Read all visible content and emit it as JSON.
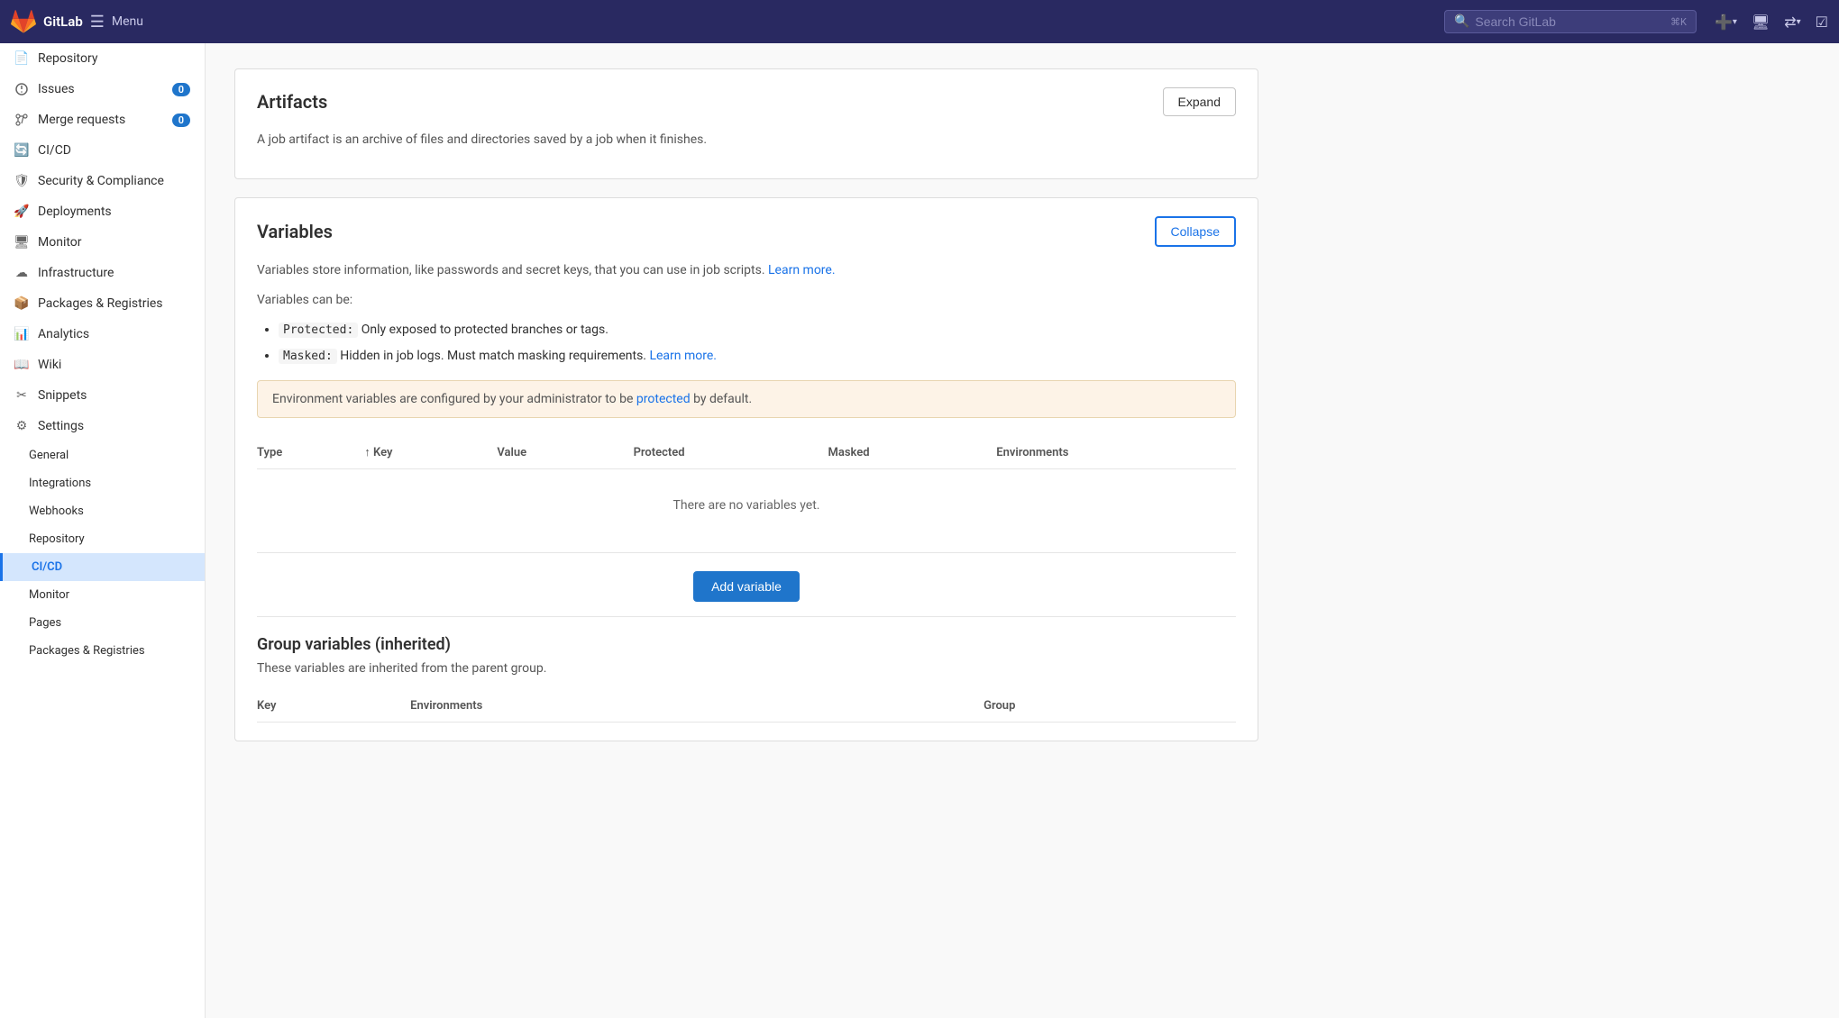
{
  "navbar": {
    "logo_text": "GitLab",
    "menu_label": "Menu",
    "search_placeholder": "Search GitLab"
  },
  "sidebar": {
    "items": [
      {
        "id": "repository",
        "label": "Repository",
        "icon": "repo-icon"
      },
      {
        "id": "issues",
        "label": "Issues",
        "icon": "issues-icon",
        "badge": "0"
      },
      {
        "id": "merge-requests",
        "label": "Merge requests",
        "icon": "merge-icon",
        "badge": "0"
      },
      {
        "id": "cicd",
        "label": "CI/CD",
        "icon": "cicd-icon"
      },
      {
        "id": "security",
        "label": "Security & Compliance",
        "icon": "shield-icon"
      },
      {
        "id": "deployments",
        "label": "Deployments",
        "icon": "deploy-icon"
      },
      {
        "id": "monitor",
        "label": "Monitor",
        "icon": "monitor-icon"
      },
      {
        "id": "infrastructure",
        "label": "Infrastructure",
        "icon": "infra-icon"
      },
      {
        "id": "packages",
        "label": "Packages & Registries",
        "icon": "package-icon"
      },
      {
        "id": "analytics",
        "label": "Analytics",
        "icon": "analytics-icon"
      },
      {
        "id": "wiki",
        "label": "Wiki",
        "icon": "wiki-icon"
      },
      {
        "id": "snippets",
        "label": "Snippets",
        "icon": "snippets-icon"
      },
      {
        "id": "settings",
        "label": "Settings",
        "icon": "settings-icon"
      }
    ],
    "sub_items": [
      {
        "id": "general",
        "label": "General"
      },
      {
        "id": "integrations",
        "label": "Integrations"
      },
      {
        "id": "webhooks",
        "label": "Webhooks"
      },
      {
        "id": "repo-settings",
        "label": "Repository"
      },
      {
        "id": "cicd-settings",
        "label": "CI/CD",
        "active": true
      },
      {
        "id": "monitor-settings",
        "label": "Monitor"
      },
      {
        "id": "pages-settings",
        "label": "Pages"
      },
      {
        "id": "packages-settings",
        "label": "Packages & Registries"
      }
    ]
  },
  "artifacts_section": {
    "title": "Artifacts",
    "description": "A job artifact is an archive of files and directories saved by a job when it finishes.",
    "expand_btn": "Expand"
  },
  "variables_section": {
    "title": "Variables",
    "description": "Variables store information, like passwords and secret keys, that you can use in job scripts.",
    "learn_more_text": "Learn more.",
    "can_be_label": "Variables can be:",
    "protected_desc": "Only exposed to protected branches or tags.",
    "masked_desc": "Hidden in job logs. Must match masking requirements.",
    "masked_learn_more": "Learn more.",
    "protected_code": "Protected:",
    "masked_code": "Masked:",
    "warning_text": "Environment variables are configured by your administrator to be",
    "warning_link": "protected",
    "warning_suffix": "by default.",
    "collapse_btn": "Collapse",
    "table_headers": {
      "type": "Type",
      "key": "Key",
      "key_sort": "↑",
      "value": "Value",
      "protected": "Protected",
      "masked": "Masked",
      "environments": "Environments"
    },
    "empty_message": "There are no variables yet.",
    "add_variable_btn": "Add variable"
  },
  "group_variables_section": {
    "title": "Group variables (inherited)",
    "description": "These variables are inherited from the parent group.",
    "table_headers": {
      "key": "Key",
      "environments": "Environments",
      "group": "Group"
    }
  }
}
